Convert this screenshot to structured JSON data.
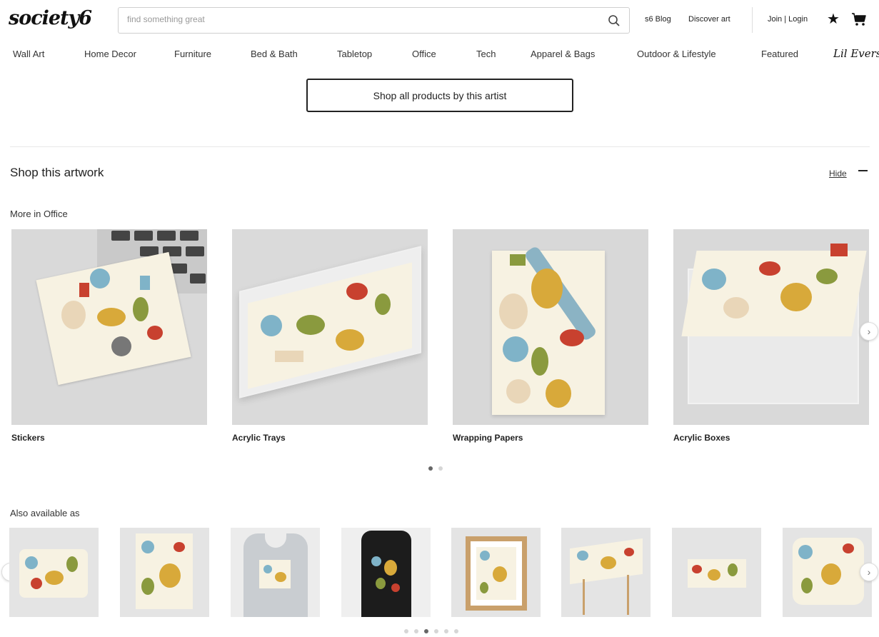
{
  "header": {
    "logo": "society6",
    "search_placeholder": "find something great",
    "blog_link": "s6 Blog",
    "discover_link": "Discover art",
    "login_link": "Join | Login"
  },
  "nav": {
    "items": [
      "Wall Art",
      "Home Decor",
      "Furniture",
      "Bed & Bath",
      "Tabletop",
      "Office",
      "Tech",
      "Apparel & Bags",
      "Outdoor & Lifestyle",
      "Featured",
      "Lil Evers"
    ]
  },
  "shop_all_button": "Shop all products by this artist",
  "shop_section": {
    "title": "Shop this artwork",
    "hide_label": "Hide",
    "more_title": "More in Office",
    "products": [
      {
        "label": "Stickers"
      },
      {
        "label": "Acrylic Trays"
      },
      {
        "label": "Wrapping Papers"
      },
      {
        "label": "Acrylic Boxes"
      }
    ],
    "carousel_pages": 2,
    "carousel_active": 0
  },
  "also_available": {
    "title": "Also available as",
    "thumbs": [
      "mouse-pad",
      "art-print",
      "v-neck-tee",
      "tank-top",
      "framed-print",
      "side-table",
      "bath-mat",
      "throw-pillow"
    ],
    "carousel_pages": 6,
    "carousel_active": 2
  },
  "colors": {
    "accent_red": "#c8412f",
    "accent_blue": "#7fb3c8",
    "accent_green": "#8a9a3e",
    "accent_yellow": "#d8a93a",
    "pattern_bg": "#f7f2e2"
  }
}
